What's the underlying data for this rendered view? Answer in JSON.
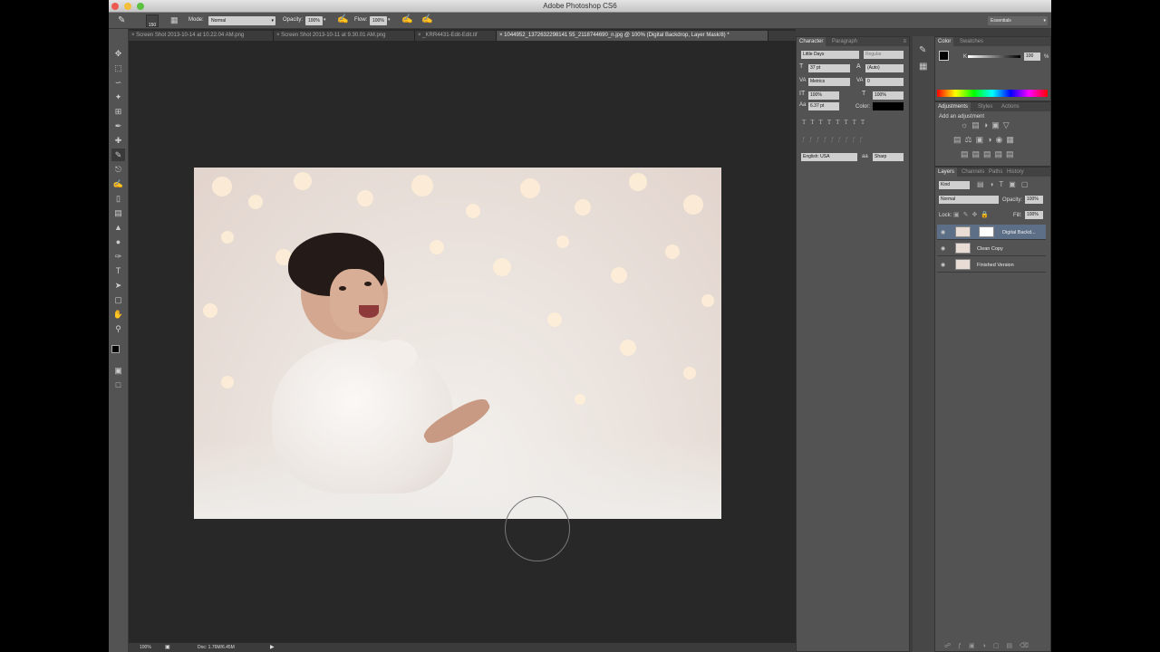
{
  "app": {
    "title": "Adobe Photoshop CS6",
    "workspace": "Essentials"
  },
  "options": {
    "brush_size": "150",
    "mode_label": "Mode:",
    "mode_value": "Normal",
    "opacity_label": "Opacity:",
    "opacity_value": "100%",
    "flow_label": "Flow:",
    "flow_value": "100%"
  },
  "tabs": [
    {
      "label": "Screen Shot 2013-10-14 at 10.22.04 AM.png"
    },
    {
      "label": "Screen Shot 2013-10-11 at 9.30.01 AM.png"
    },
    {
      "label": "_KRR4431-Edit-Edit.tif"
    },
    {
      "label": "1044952_1372632298141 55_2118744690_n.jpg @ 100% (Digital Backdrop, Layer Mask/8) *"
    }
  ],
  "status": {
    "zoom": "100%",
    "doc": "Doc: 1.76M/6.45M"
  },
  "character": {
    "tab_character": "Character",
    "tab_paragraph": "Paragraph",
    "font_family": "Little Days",
    "font_style": "Regular",
    "font_size": "37 pt",
    "leading": "(Auto)",
    "kerning": "Metrics",
    "tracking": "0",
    "vscale": "100%",
    "hscale": "100%",
    "baseline": "6.37 pt",
    "color_label": "Color:",
    "language": "English: USA",
    "aa_label": "aa",
    "antialias": "Sharp"
  },
  "color": {
    "tab_color": "Color",
    "tab_swatches": "Swatches",
    "k_label": "K",
    "k_value": "100",
    "percent": "%"
  },
  "adjustments": {
    "tab_adjustments": "Adjustments",
    "tab_styles": "Styles",
    "tab_actions": "Actions",
    "add_label": "Add an adjustment"
  },
  "layers": {
    "tab_layers": "Layers",
    "tab_channels": "Channels",
    "tab_paths": "Paths",
    "tab_history": "History",
    "kind": "Kind",
    "blend": "Normal",
    "opacity_label": "Opacity:",
    "opacity": "100%",
    "lock_label": "Lock:",
    "fill_label": "Fill:",
    "fill": "100%",
    "items": [
      {
        "name": "Digital Backd..."
      },
      {
        "name": "Clean Copy"
      },
      {
        "name": "Finished Version"
      }
    ]
  }
}
